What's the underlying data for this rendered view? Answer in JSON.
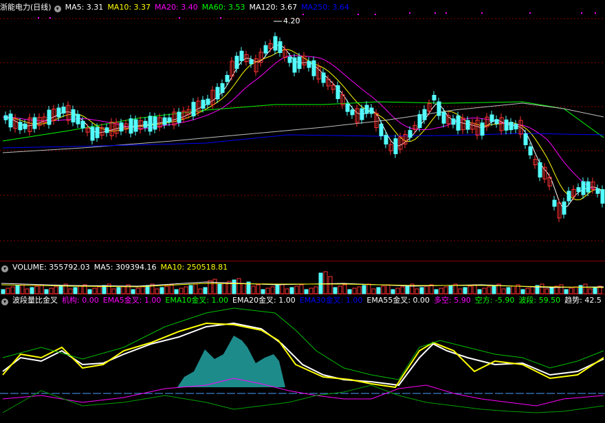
{
  "price_panel": {
    "title": "浙能电力(日线)",
    "ma_labels": [
      {
        "text": "MA5: 3.31",
        "color": "#ffffff"
      },
      {
        "text": "MA10: 3.37",
        "color": "#ffff00"
      },
      {
        "text": "MA20: 3.40",
        "color": "#ff00ff"
      },
      {
        "text": "MA60: 3.53",
        "color": "#00ff00"
      },
      {
        "text": "MA120: 3.67",
        "color": "#ffffff"
      },
      {
        "text": "MA250: 3.64",
        "color": "#0000ff"
      }
    ],
    "high_marker": "4.20"
  },
  "volume_panel": {
    "labels": [
      {
        "text": "VOLUME: 355792.03",
        "color": "#ffffff"
      },
      {
        "text": "MA5: 309394.16",
        "color": "#ffffff"
      },
      {
        "text": "MA10: 250518.81",
        "color": "#ffff00"
      }
    ]
  },
  "indicator_panel": {
    "labels": [
      {
        "text": "波段量比金叉",
        "color": "#ffffff"
      },
      {
        "text": "机构: 0.00",
        "color": "#ff00ff"
      },
      {
        "text": "EMA5金叉: 1.00",
        "color": "#ff00ff"
      },
      {
        "text": "EMA10金叉: 1.00",
        "color": "#00ff00"
      },
      {
        "text": "EMA20金叉: 1.00",
        "color": "#ffffff"
      },
      {
        "text": "EMA30金叉: 1.00",
        "color": "#0000ff"
      },
      {
        "text": "EMA55金叉: 0.00",
        "color": "#ffffff"
      },
      {
        "text": "多空: 5.90",
        "color": "#ff00ff"
      },
      {
        "text": "空方: -5.90",
        "color": "#00ff00"
      },
      {
        "text": "波段: 59.50",
        "color": "#00ff00"
      },
      {
        "text": "趋势: 42.5",
        "color": "#ffffff"
      }
    ]
  },
  "colors": {
    "up": "#ff3232",
    "down": "#54ffff",
    "grid": "#8b0000",
    "ma5": "#ffffff",
    "ma10": "#ffff00",
    "ma20": "#ff00ff",
    "ma60": "#00ff00",
    "ma120": "#c0c0c0",
    "ma250": "#0000ff"
  }
}
